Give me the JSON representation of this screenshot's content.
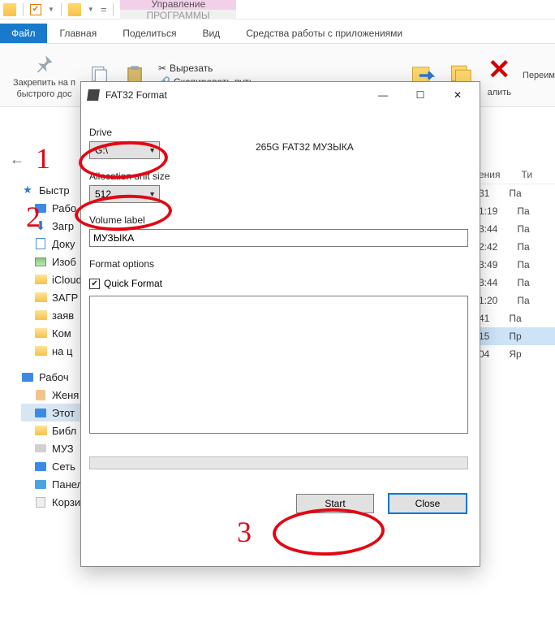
{
  "qat": {
    "equals": "="
  },
  "tabs": {
    "file": "Файл",
    "home": "Главная",
    "share": "Поделиться",
    "view": "Вид",
    "apptools": "Средства работы с приложениями",
    "manage": "Управление",
    "programs": "ПРОГРАММЫ"
  },
  "ribbon": {
    "pin1": "Закрепить на п",
    "pin2": "быстрого дос",
    "cut": "Вырезать",
    "copypath": "Скопировать путь",
    "delete_trail": "алить",
    "rename_trail": "Переим"
  },
  "tree": {
    "quick": "Быстр",
    "desktop": "Рабо",
    "downloads": "Загр",
    "documents": "Доку",
    "pictures": "Изоб",
    "icloud": "iCloud",
    "zagr": "ЗАГР",
    "zayav": "заяв",
    "comp": "Ком",
    "nats": "на ц",
    "rabst": "Рабоч",
    "zhenya": "Женя",
    "thispc": "Этот",
    "libs": "Библ",
    "music": "МУЗ",
    "network": "Сеть",
    "cpanel": "Панель управл",
    "recycle": "Корзина"
  },
  "list": {
    "hdr_mod": "ения",
    "hdr_type": "Ти",
    "rows": [
      {
        "t": "31",
        "ty": "Па"
      },
      {
        "t": "1:19",
        "ty": "Па"
      },
      {
        "t": "3:44",
        "ty": "Па"
      },
      {
        "t": "2:42",
        "ty": "Па"
      },
      {
        "t": "3:49",
        "ty": "Па"
      },
      {
        "t": "3:44",
        "ty": "Па"
      },
      {
        "t": "1:20",
        "ty": "Па"
      },
      {
        "t": "41",
        "ty": "Па"
      },
      {
        "t": "15",
        "ty": "Пр"
      },
      {
        "t": "04",
        "ty": "Яр"
      }
    ]
  },
  "dialog": {
    "title": "FAT32 Format",
    "drive_label": "Drive",
    "drive_value": "G:\\",
    "drive_info": "265G FAT32 МУЗЫКА",
    "alloc_label": "Allocation unit size",
    "alloc_value": "512",
    "vol_label": "Volume label",
    "vol_value": "МУЗЫКА",
    "fmt_opts": "Format options",
    "quick_fmt": "Quick Format",
    "start": "Start",
    "close": "Close"
  },
  "anno": {
    "n1": "1",
    "n2": "2",
    "n3": "3"
  }
}
